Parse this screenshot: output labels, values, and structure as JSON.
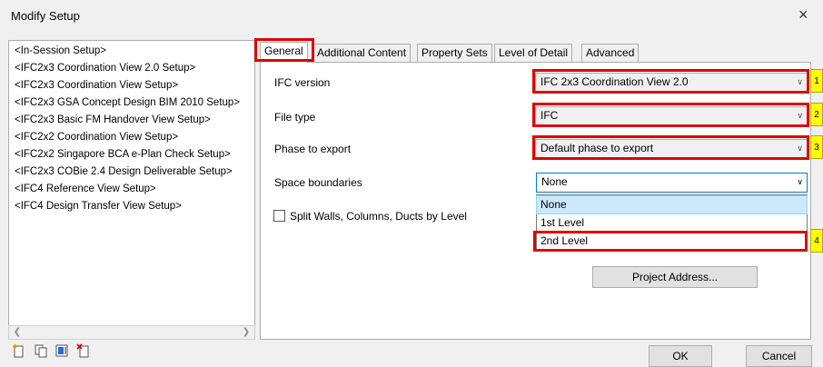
{
  "dialog": {
    "title": "Modify Setup",
    "close_glyph": "×"
  },
  "setups": [
    "<In-Session Setup>",
    "<IFC2x3 Coordination View 2.0 Setup>",
    "<IFC2x3 Coordination View Setup>",
    "<IFC2x3 GSA Concept Design BIM 2010 Setup>",
    "<IFC2x3 Basic FM Handover View Setup>",
    "<IFC2x2 Coordination View Setup>",
    "<IFC2x2 Singapore BCA e-Plan Check Setup>",
    "<IFC2x3 COBie 2.4 Design Deliverable Setup>",
    "<IFC4 Reference View Setup>",
    "<IFC4 Design Transfer View Setup>"
  ],
  "tabs": [
    "General",
    "Additional Content",
    "Property Sets",
    "Level of Detail",
    "Advanced"
  ],
  "general": {
    "ifc_version_label": "IFC version",
    "ifc_version_value": "IFC 2x3 Coordination View 2.0",
    "file_type_label": "File type",
    "file_type_value": "IFC",
    "phase_label": "Phase to export",
    "phase_value": "Default phase to export",
    "space_boundaries_label": "Space boundaries",
    "space_boundaries_value": "None",
    "space_boundaries_options": [
      "None",
      "1st Level",
      "2nd Level"
    ],
    "split_label": "Split Walls, Columns, Ducts by Level",
    "project_address_button": "Project Address..."
  },
  "markers": [
    "1",
    "2",
    "3",
    "4"
  ],
  "footer": {
    "ok": "OK",
    "cancel": "Cancel"
  },
  "icons": [
    "new-setup-icon",
    "duplicate-setup-icon",
    "rename-setup-icon",
    "delete-setup-icon"
  ],
  "colors": {
    "highlight": "#e00000",
    "marker": "#ffff00",
    "selection": "#cce8ff",
    "focus": "#0078d7"
  }
}
